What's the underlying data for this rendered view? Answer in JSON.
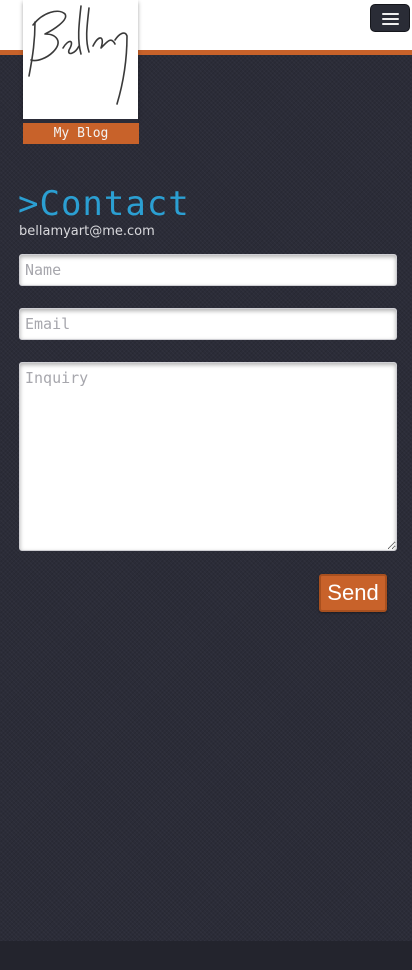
{
  "header": {
    "menu_icon": "hamburger-menu-icon",
    "logo_icon": "bellamy-signature-logo",
    "logo_text": "Bellamy",
    "blog_label": "My Blog"
  },
  "contact": {
    "heading": ">Contact",
    "email": "bellamyart@me.com"
  },
  "form": {
    "name_placeholder": "Name",
    "email_placeholder": "Email",
    "inquiry_placeholder": "Inquiry",
    "send_label": "Send"
  },
  "colors": {
    "accent": "#c8622a",
    "heading": "#2b9fd2",
    "background": "#2b2c38"
  }
}
